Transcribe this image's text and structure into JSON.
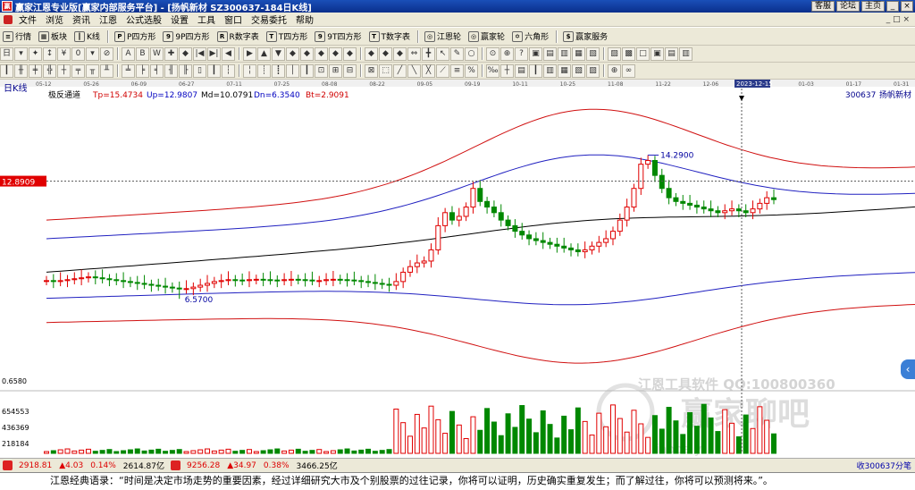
{
  "window": {
    "title": "赢家江恩专业版[赢家内部服务平台] - [扬帆新材  SZ300637-184日K线]",
    "logo_char": "赢",
    "buttons": [
      "客服",
      "论坛",
      "主页"
    ],
    "ctrl_min": "_",
    "ctrl_close": "×"
  },
  "menu": {
    "items": [
      "文件",
      "浏览",
      "资讯",
      "江恩",
      "公式选股",
      "设置",
      "工具",
      "窗口",
      "交易委托",
      "帮助"
    ],
    "clock": "_ □ ×"
  },
  "toolbar1": {
    "items": [
      {
        "icon": "≡",
        "label": "行情"
      },
      {
        "icon": "▦",
        "label": "板块"
      },
      {
        "icon": "┃",
        "label": "K线"
      },
      {
        "icon": "P",
        "label": "P四方形"
      },
      {
        "icon": "9",
        "label": "9P四方形"
      },
      {
        "icon": "R",
        "label": "R数字表"
      },
      {
        "icon": "T",
        "label": "T四方形"
      },
      {
        "icon": "9",
        "label": "9T四方形"
      },
      {
        "icon": "T",
        "label": "T数字表"
      },
      {
        "icon": "◎",
        "label": "江恩轮"
      },
      {
        "icon": "◎",
        "label": "赢家轮"
      },
      {
        "icon": "✡",
        "label": "六角形"
      },
      {
        "icon": "$",
        "label": "赢家服务"
      }
    ]
  },
  "toolbar2": {
    "buttons": [
      "日",
      "▾",
      "✦",
      "↕",
      "¥",
      "0",
      "▾",
      "⊘",
      "A",
      "B",
      "W",
      "✚",
      "◆",
      "|◀",
      "▶|",
      "◀",
      "▶",
      "▲",
      "▼",
      "◆",
      "◆",
      "◆",
      "◆",
      "◆",
      "◆",
      "◆",
      "◆",
      "⇔",
      "╋",
      "↖",
      "✎",
      "○",
      "⊙",
      "⊕",
      "?",
      "▣",
      "▤",
      "▥",
      "▦",
      "▧",
      "▨",
      "▩",
      "□",
      "▣",
      "▤",
      "▥"
    ]
  },
  "toolbar3": {
    "buttons": [
      "┃",
      "╫",
      "╪",
      "╬",
      "┼",
      "╤",
      "╥",
      "╨",
      "╧",
      "╞",
      "╡",
      "╢",
      "╟",
      "▯",
      "┃",
      "┆",
      "╎",
      "┊",
      "┋",
      "│",
      "┃",
      "⊡",
      "⊞",
      "⊟",
      "⊠",
      "⬚",
      "╱",
      "╲",
      "╳",
      "⟋",
      "≡",
      "%",
      "‰",
      "┼",
      "▤",
      "┃",
      "▥",
      "▦",
      "▧",
      "▨",
      "⊕",
      "∞"
    ]
  },
  "chart_data": {
    "type": "candlestick",
    "period_label": "日K线",
    "indicator": {
      "name": "极反通道",
      "tp_label": "Tp=15.4734",
      "up_label": "Up=12.9807",
      "md_label": "Md=10.0791",
      "dn_label": "Dn=6.3540",
      "bt_label": "Bt=2.9091"
    },
    "stock": {
      "code": "300637",
      "name": "扬帆新材"
    },
    "date_ticks": [
      "05-12",
      "05-26",
      "06-09",
      "06-27",
      "07-11",
      "07-25",
      "08-08",
      "08-22",
      "09-05",
      "09-19",
      "10-11",
      "10-25",
      "11-08",
      "11-22",
      "12-06",
      "2023-12-15",
      "01-03",
      "01-17",
      "01-31"
    ],
    "crosshair_date": "2023-12-15",
    "crosshair_price_label": "12.8909",
    "crosshair_price": 12.8909,
    "high_label": "14.2900",
    "low_label": "6.5700",
    "high_value": 14.29,
    "low_value": 6.57,
    "ylim": [
      2.5,
      17.0
    ],
    "volume_axis": [
      "0.6580",
      "654553",
      "436369",
      "218184"
    ],
    "volume_max": 654553,
    "closes": [
      7.55,
      7.5,
      7.55,
      7.6,
      7.65,
      7.7,
      7.75,
      7.7,
      7.65,
      7.6,
      7.55,
      7.5,
      7.45,
      7.4,
      7.35,
      7.3,
      7.25,
      7.2,
      7.15,
      7.1,
      7.12,
      7.2,
      7.3,
      7.4,
      7.5,
      7.55,
      7.6,
      7.58,
      7.55,
      7.6,
      7.62,
      7.6,
      7.58,
      7.55,
      7.6,
      7.62,
      7.6,
      7.58,
      7.55,
      7.55,
      7.6,
      7.62,
      7.6,
      7.58,
      7.55,
      7.5,
      7.45,
      7.4,
      7.35,
      7.3,
      7.5,
      8.0,
      8.3,
      8.5,
      8.6,
      9.2,
      10.5,
      11.2,
      10.8,
      11.0,
      11.5,
      12.5,
      11.8,
      11.5,
      11.2,
      10.8,
      10.5,
      10.2,
      10.0,
      9.8,
      9.7,
      9.6,
      9.5,
      9.4,
      9.3,
      9.2,
      9.1,
      9.2,
      9.4,
      9.6,
      9.8,
      10.2,
      10.8,
      11.5,
      12.5,
      13.8,
      14.0,
      13.2,
      12.5,
      12.0,
      11.8,
      11.7,
      11.6,
      11.5,
      11.4,
      11.3,
      11.2,
      11.3,
      11.4,
      11.3,
      11.2,
      11.4,
      11.7,
      12.0,
      11.9
    ],
    "channels": {
      "tp_start": 10.8,
      "tp_end": 13.6,
      "up_start": 9.8,
      "up_end": 12.2,
      "md_start": 8.0,
      "md_end": 11.5,
      "dn_start": 6.6,
      "dn_end": 8.0,
      "bt_start": 5.3,
      "bt_end": 6.3
    }
  },
  "watermark": {
    "line1": "江恩工具软件  QQ:100800360",
    "line2": "赢家聊吧",
    "line3": "liaoba.y..."
  },
  "status": {
    "index1_price": "2918.81",
    "index1_change": "▲4.03",
    "index1_pct": "0.14%",
    "index1_amount": "2614.87亿",
    "index2_price": "9256.28",
    "index2_change": "▲34.97",
    "index2_pct": "0.38%",
    "index2_amount": "3466.25亿",
    "right_text": "收300637分笔"
  },
  "quote": {
    "text": "江恩经典语录：“时间是决定市场走势的重要因素，经过详细研究大市及个别股票的过往记录，你将可以证明，历史确实重复发生；而了解过往，你将可以预测将来。”。"
  },
  "side_button": "‹",
  "colors": {
    "up": "#e00000",
    "down": "#008800",
    "tp": "#d01010",
    "up_line": "#2020c0",
    "md": "#000000"
  }
}
